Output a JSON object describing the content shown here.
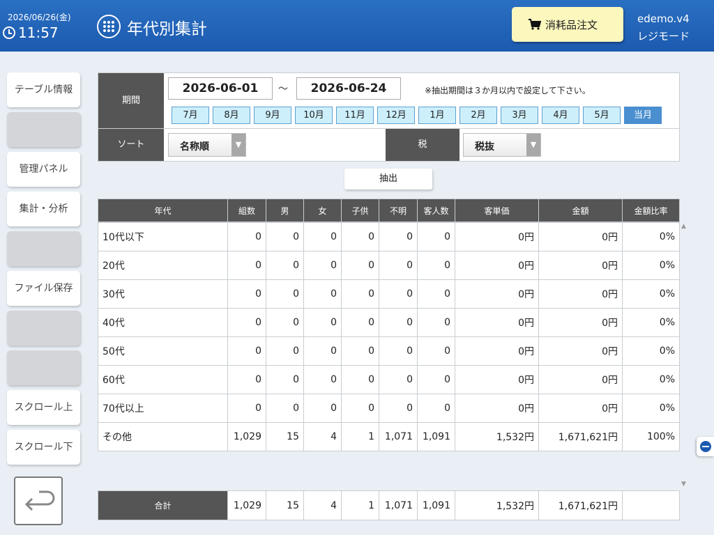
{
  "header": {
    "date": "2026/06/26(金)",
    "time": "11:57",
    "title": "年代別集計",
    "order_button": "消耗品注文",
    "version": "edemo.v4",
    "mode": "レジモード"
  },
  "sidebar": {
    "items": [
      {
        "label": "テーブル情報"
      },
      {
        "label": ""
      },
      {
        "label": "管理パネル"
      },
      {
        "label": "集計・分析"
      },
      {
        "label": ""
      },
      {
        "label": "ファイル保存"
      },
      {
        "label": ""
      },
      {
        "label": ""
      },
      {
        "label": "スクロール上"
      },
      {
        "label": "スクロール下"
      }
    ]
  },
  "filter": {
    "period_label": "期間",
    "start_date": "2026-06-01",
    "separator": "～",
    "end_date": "2026-06-24",
    "note": "※抽出期間は３か月以内で設定して下さい。",
    "months": [
      "7月",
      "8月",
      "9月",
      "10月",
      "11月",
      "12月",
      "1月",
      "2月",
      "3月",
      "4月",
      "5月",
      "当月"
    ],
    "active_month": "当月",
    "sort_label": "ソート",
    "sort_value": "名称順",
    "tax_label": "税",
    "tax_value": "税抜",
    "extract_button": "抽出"
  },
  "table": {
    "headers": [
      "年代",
      "組数",
      "男",
      "女",
      "子供",
      "不明",
      "客人数",
      "客単価",
      "金額",
      "金額比率"
    ],
    "rows": [
      [
        "10代以下",
        "0",
        "0",
        "0",
        "0",
        "0",
        "0",
        "0円",
        "0円",
        "0%"
      ],
      [
        "20代",
        "0",
        "0",
        "0",
        "0",
        "0",
        "0",
        "0円",
        "0円",
        "0%"
      ],
      [
        "30代",
        "0",
        "0",
        "0",
        "0",
        "0",
        "0",
        "0円",
        "0円",
        "0%"
      ],
      [
        "40代",
        "0",
        "0",
        "0",
        "0",
        "0",
        "0",
        "0円",
        "0円",
        "0%"
      ],
      [
        "50代",
        "0",
        "0",
        "0",
        "0",
        "0",
        "0",
        "0円",
        "0円",
        "0%"
      ],
      [
        "60代",
        "0",
        "0",
        "0",
        "0",
        "0",
        "0",
        "0円",
        "0円",
        "0%"
      ],
      [
        "70代以上",
        "0",
        "0",
        "0",
        "0",
        "0",
        "0",
        "0円",
        "0円",
        "0%"
      ],
      [
        "その他",
        "1,029",
        "15",
        "4",
        "1",
        "1,071",
        "1,091",
        "1,532円",
        "1,671,621円",
        "100%"
      ]
    ],
    "total": [
      "合計",
      "1,029",
      "15",
      "4",
      "1",
      "1,071",
      "1,091",
      "1,532円",
      "1,671,621円",
      ""
    ]
  },
  "icons": {
    "clock": "clock-icon",
    "menu": "grid-menu-icon",
    "cart": "cart-icon",
    "back": "return-arrow-icon",
    "remote": "remote-support-icon"
  },
  "colors": {
    "header": "#1c5ab0",
    "order_button": "#fbf7bd",
    "label_bg": "#555555",
    "month_button": "#cdeffc",
    "month_active": "#4a8fd0"
  }
}
